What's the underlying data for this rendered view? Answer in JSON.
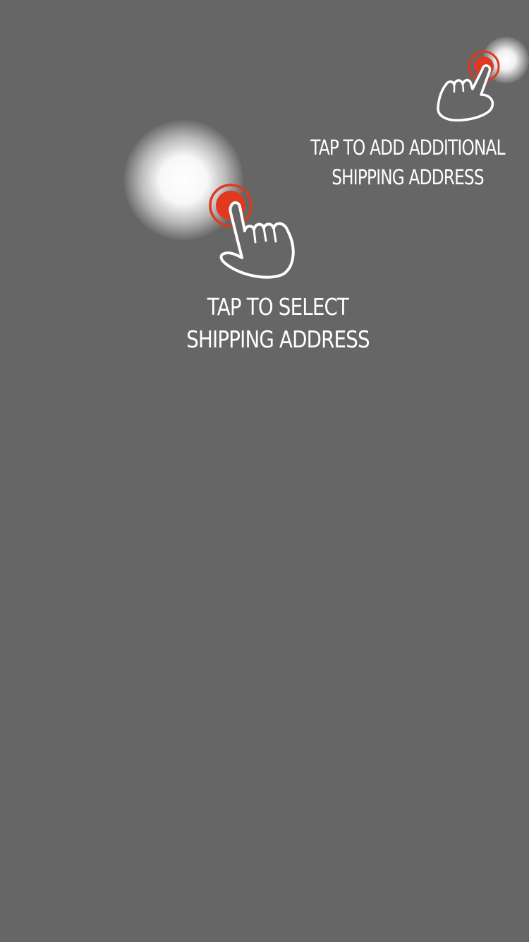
{
  "overlay": {
    "background_color": "#666666",
    "accent_color": "#e0391f",
    "text_color": "#ffffff"
  },
  "hint_select": {
    "icon": "tap-hand-icon",
    "lines": [
      "TAP TO SELECT",
      "SHIPPING ADDRESS"
    ]
  },
  "hint_add": {
    "icon": "tap-hand-icon",
    "lines": [
      "TAP TO ADD ADDITIONAL",
      "SHIPPING ADDRESS"
    ]
  }
}
